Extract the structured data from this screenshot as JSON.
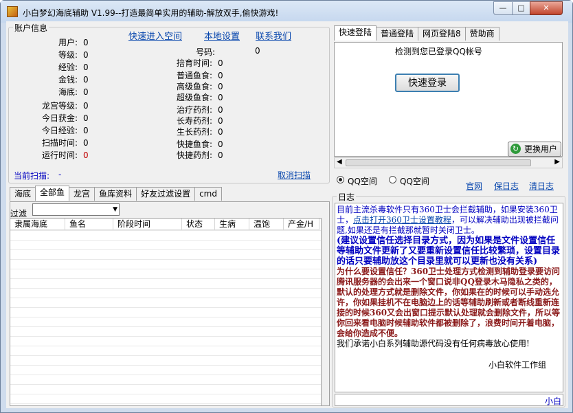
{
  "window": {
    "title": "小白梦幻海底辅助 V1.99--打造最简单实用的辅助-解放双手,偷快游戏!",
    "minimize": "—",
    "maximize": "□",
    "close": "✕"
  },
  "account": {
    "title": "账户信息",
    "links": [
      "快速进入空间",
      "本地设置",
      "联系我们"
    ],
    "left": [
      [
        "用户:",
        "0"
      ],
      [
        "等级:",
        "0"
      ],
      [
        "经验:",
        "0"
      ],
      [
        "金钱:",
        "0"
      ],
      [
        "海底:",
        "0"
      ],
      [
        "龙宫等级:",
        "0"
      ],
      [
        "今日获金:",
        "0"
      ],
      [
        "今日经验:",
        "0"
      ],
      [
        "扫描时间:",
        "0"
      ],
      [
        "运行时间:",
        "0"
      ]
    ],
    "qq_label": "号码:",
    "qq_value": "0",
    "right": [
      [
        "掊育时间:",
        "0"
      ],
      [
        "普通鱼食:",
        "0"
      ],
      [
        "高级鱼食:",
        "0"
      ],
      [
        "超级鱼食:",
        "0"
      ],
      [
        "治疗药剂:",
        "0"
      ],
      [
        "长寿药剂:",
        "0"
      ],
      [
        "生长药剂:",
        "0"
      ],
      [
        "快捷鱼食:",
        "0"
      ],
      [
        "快捷药剂:",
        "0"
      ]
    ],
    "scan_label": "当前扫描:",
    "scan_value": "-",
    "cancel_scan": "取消扫描"
  },
  "lower_tabs": [
    "海底",
    "全部鱼",
    "龙宫",
    "鱼库资料",
    "好友过滤设置",
    "cmd"
  ],
  "filter_label": "过滤",
  "filter_value": "",
  "grid_columns": [
    "隶属海底",
    "鱼名",
    "阶段时间",
    "状态",
    "生病",
    "温饱",
    "产金/H"
  ],
  "login_tabs": [
    "快速登陆",
    "普通登陆",
    "网页登陆8",
    "赞助商"
  ],
  "login": {
    "detected": "检测到您已登录QQ帐号",
    "quick_login": "快速登录",
    "switch_user": "更换用户"
  },
  "space": {
    "opt1": "QQ空间",
    "opt2": "QQ空间",
    "links": [
      "官网",
      "保日志",
      "清日志"
    ]
  },
  "log": {
    "title": "日志",
    "p1a": "目前主流杀毒软件只有360卫士会拦截辅助，如果安装360卫士，",
    "p1link": "点击打开360卫士设置教程",
    "p1b": "，可以解决辅助出现被拦截问题,如果还是有拦截那就暂时关闭卫士。",
    "p2": "(建议设置信任选择目录方式，因为如果是文件设置信任等辅助文件更新了又要重新设置信任比较繁琐，设置目录的话只要辅助放这个目录里就可以更新也没有关系)",
    "p3": "为什么要设置信任？360卫士处理方式检测到辅助登录要访问腾讯服务器的会出来一个窗口说非QQ登录木马隐私之类的，默认的处理方式就是删除文件，你如果在的时候可以手动选允许，你如果挂机不在电脑边上的话等辅助刷新或者断线重新连接的时候360又会出窗口提示默认处理就会删除文件，所以等你回来看电脑时候辅助软件都被删除了，浪费时间开着电脑，会给你造成不便。",
    "p4": "我们承诺小白系列辅助源代码没有任何病毒放心使用!",
    "sign": "小白软件工作组",
    "status": "小白"
  }
}
